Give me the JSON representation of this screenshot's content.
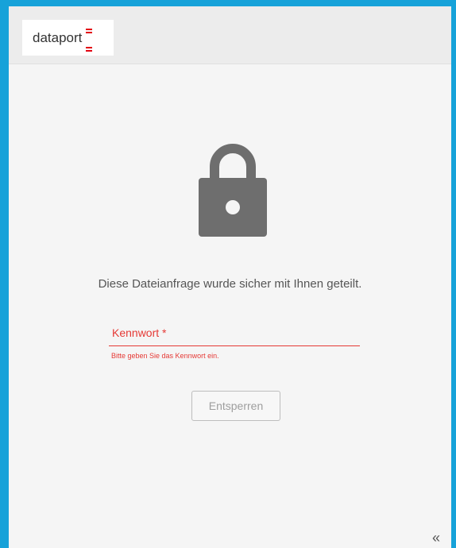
{
  "header": {
    "logo_text": "dataport",
    "brand_color": "#e30613",
    "border_color": "#17a2d9"
  },
  "main": {
    "icon": "lock-icon",
    "message": "Diese Dateianfrage wurde sicher mit Ihnen geteilt.",
    "password_field": {
      "label": "Kennwort *",
      "value": "",
      "error": "Bitte geben Sie das Kennwort ein."
    },
    "unlock_button_label": "Entsperren"
  },
  "footer": {
    "collapse_glyph": "«"
  }
}
